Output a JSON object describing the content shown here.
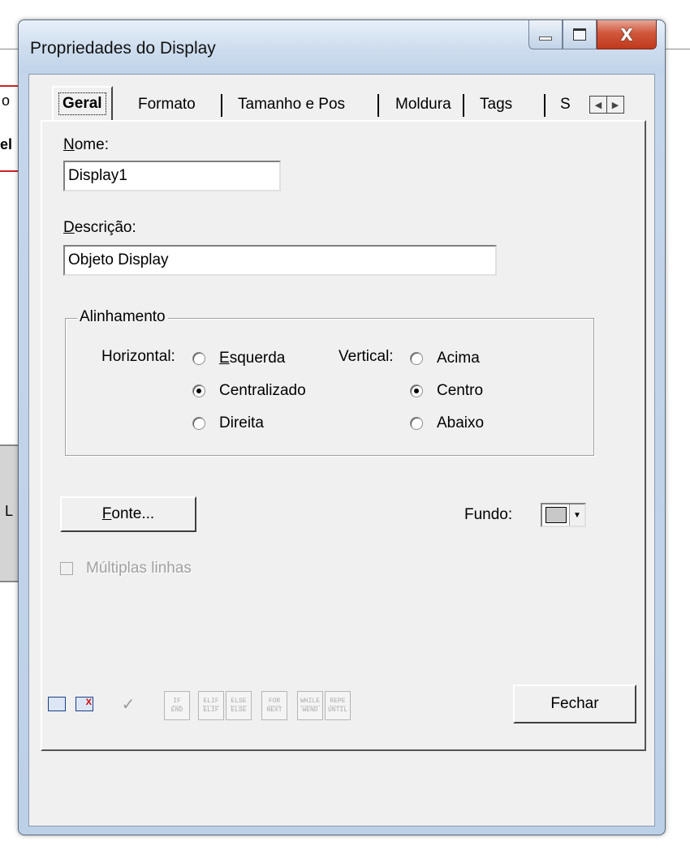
{
  "background": {
    "frag1": "o",
    "frag2": "el",
    "frag3": "L"
  },
  "window": {
    "title": "Propriedades do Display",
    "close_glyph": "X"
  },
  "tabs": [
    {
      "label": "Geral",
      "active": true
    },
    {
      "label": "Formato",
      "active": false
    },
    {
      "label": "Tamanho e Pos",
      "active": false
    },
    {
      "label": "Moldura",
      "active": false
    },
    {
      "label": "Tags",
      "active": false
    },
    {
      "label": "S",
      "active": false
    }
  ],
  "tab_scroll": {
    "left": "◀",
    "right": "▶"
  },
  "fields": {
    "nome_label_first": "N",
    "nome_label_rest": "ome:",
    "nome_value": "Display1",
    "descricao_label_first": "D",
    "descricao_label_rest": "escrição:",
    "descricao_value": "Objeto Display"
  },
  "alignment": {
    "group_title": "Alinhamento",
    "horizontal_label": "Horizontal:",
    "vertical_label": "Vertical:",
    "horizontal_options": [
      {
        "first": "E",
        "rest": "squerda",
        "checked": false
      },
      {
        "first": "",
        "rest": "Centralizado",
        "checked": true
      },
      {
        "first": "",
        "rest": "Direita",
        "checked": false
      }
    ],
    "vertical_options": [
      {
        "first": "",
        "rest": "Acima",
        "checked": false
      },
      {
        "first": "",
        "rest": "Centro",
        "checked": true
      },
      {
        "first": "",
        "rest": "Abaixo",
        "checked": false
      }
    ],
    "h_text": [
      "Esquerda",
      "Centralizado",
      "Direita"
    ],
    "v_text": [
      "Acima",
      "Centro",
      "Abaixo"
    ]
  },
  "font_button": {
    "first": "F",
    "rest": "onte..."
  },
  "background_color": {
    "label": "Fundo:",
    "swatch": "#c8c8c8"
  },
  "multiline": {
    "label": "Múltiplas linhas",
    "checked": false,
    "enabled": false
  },
  "toolbar": {
    "code_buttons": [
      {
        "top": "IF",
        "bottom": "END"
      },
      {
        "top": "ELIF",
        "bottom": "ELIF"
      },
      {
        "top": "ELSE",
        "bottom": "ELSE"
      },
      {
        "top": "FOR",
        "bottom": "NEXT"
      },
      {
        "top": "WHILE",
        "bottom": "WEND"
      },
      {
        "top": "REPE",
        "bottom": "UNTIL"
      }
    ],
    "close_label": "Fechar"
  }
}
